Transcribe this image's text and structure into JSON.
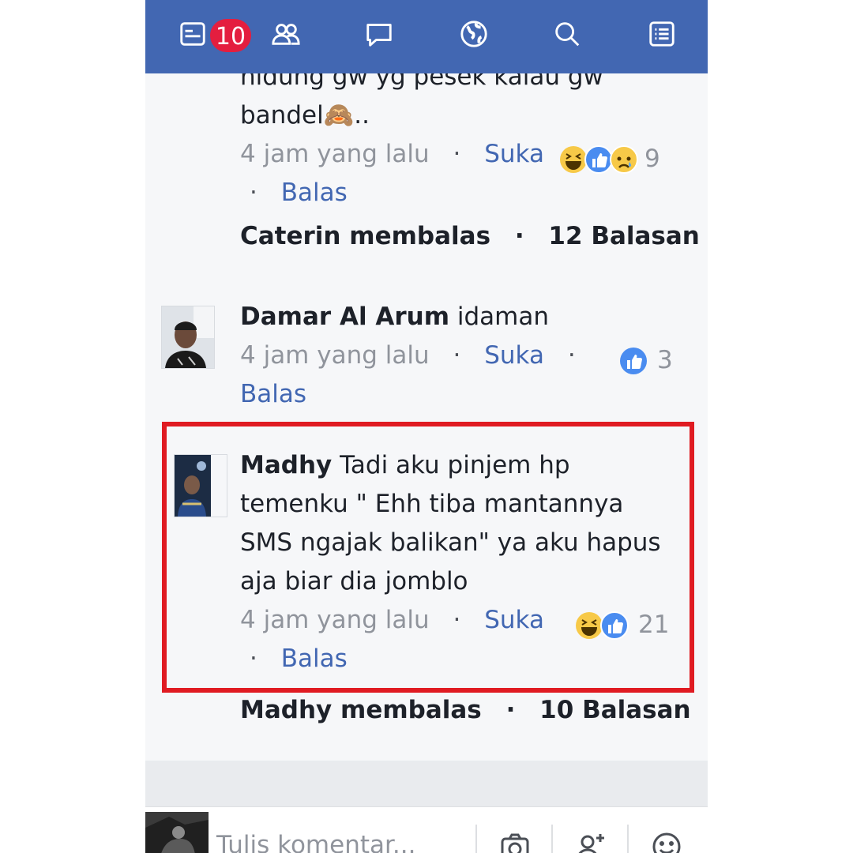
{
  "nav": {
    "notification_count": "10",
    "icons": [
      "news-feed-icon",
      "friends-icon",
      "messages-icon",
      "globe-icon",
      "search-icon",
      "menu-icon"
    ],
    "color": "#4267b2"
  },
  "comments": [
    {
      "text_line1": "hidung gw yg pesek kalau gw",
      "text_line2": "bandel🙈..",
      "time": "4 jam yang lalu",
      "like": "Suka",
      "reply": "Balas",
      "reactions": [
        "haha-icon",
        "like-icon",
        "sad-icon"
      ],
      "reaction_count": "9",
      "reply_summary_name": "Caterin membalas",
      "reply_summary_count": "12 Balasan"
    },
    {
      "author": "Damar Al Arum",
      "text": "idaman",
      "time": "4 jam yang lalu",
      "like": "Suka",
      "reply": "Balas",
      "reactions": [
        "like-icon"
      ],
      "reaction_count": "3"
    },
    {
      "author": "Madhy",
      "text_line1": "Tadi aku pinjem hp",
      "text_line2": "temenku \" Ehh tiba mantannya",
      "text_line3": "SMS ngajak balikan\" ya aku hapus",
      "text_line4": "aja biar dia jomblo",
      "time": "4 jam yang lalu",
      "like": "Suka",
      "reply": "Balas",
      "reactions": [
        "haha-icon",
        "like-icon"
      ],
      "reaction_count": "21",
      "reply_summary_name": "Madhy membalas",
      "reply_summary_count": "10 Balasan"
    }
  ],
  "composer": {
    "placeholder": "Tulis komentar..."
  },
  "colors": {
    "link": "#4267b2",
    "highlight": "#e01b22",
    "badge": "#e41e3f"
  }
}
